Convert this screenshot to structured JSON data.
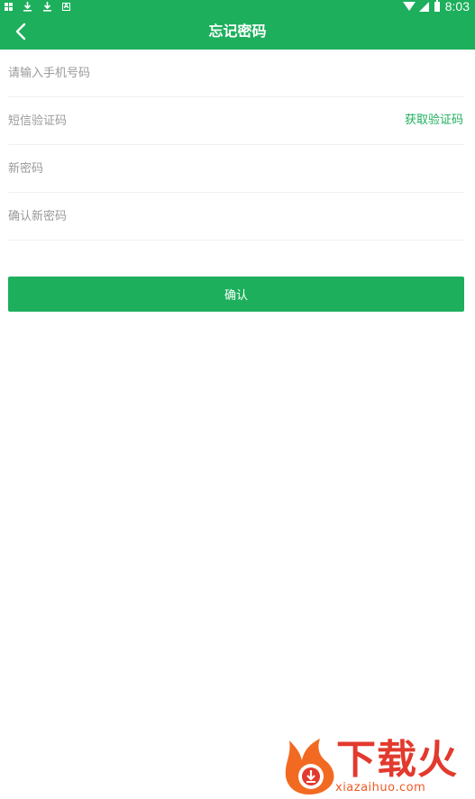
{
  "status_bar": {
    "time": "8:03",
    "left_icons": [
      "grid-icon",
      "download-icon",
      "download-icon",
      "a-badge-icon"
    ],
    "right_icons": [
      "wifi-icon",
      "signal-icon",
      "battery-icon"
    ]
  },
  "header": {
    "title": "忘记密码",
    "back_icon": "chevron-left-icon"
  },
  "form": {
    "phone": {
      "value": "",
      "placeholder": "请输入手机号码"
    },
    "sms_code": {
      "value": "",
      "placeholder": "短信验证码"
    },
    "get_code_label": "获取验证码",
    "new_password": {
      "value": "",
      "placeholder": "新密码"
    },
    "confirm_password": {
      "value": "",
      "placeholder": "确认新密码"
    }
  },
  "confirm_button": {
    "label": "确认"
  },
  "watermark": {
    "brand": "下载火",
    "domain": "xiazaihuo.com"
  },
  "colors": {
    "primary": "#1daf5c",
    "placeholder": "#9a9a9a",
    "divider": "#f0f0f0",
    "watermark_red": "#e23a2e",
    "watermark_orange": "#ef5a25"
  }
}
